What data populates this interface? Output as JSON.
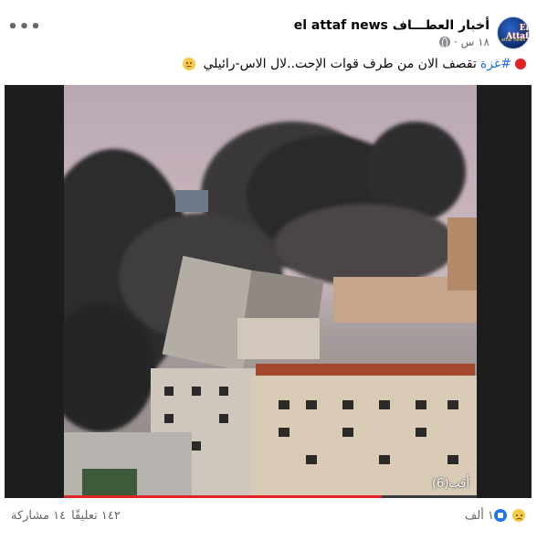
{
  "post": {
    "page_name": "أخبار العطـــاف el attaf news",
    "avatar_text": "El Attaf",
    "avatar_subtext": "attaf news",
    "time": "١٨ س",
    "separator": "·",
    "more_label": "•••",
    "text_hashtag": "#غزة",
    "text_body": "تقصف الان من طرف قوات الإحت..لال الاس-رائيلي",
    "media": {
      "watermark": "أقب(6)",
      "progress": 0.77
    }
  },
  "footer": {
    "reactions_count": "١ ألف",
    "comments": "١٤٢ تعليقًا",
    "shares": "١٤ مشاركة"
  },
  "icons": [
    "red-dot-icon",
    "globe-icon",
    "emoji-sad-icon",
    "react-sad-icon",
    "react-like-icon",
    "more-icon"
  ]
}
